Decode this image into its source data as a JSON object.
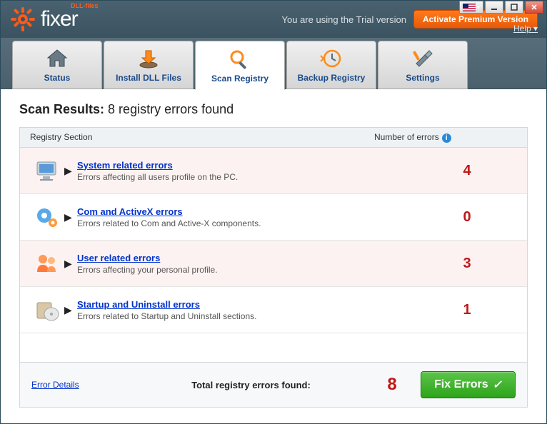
{
  "titlebar": {
    "brand_small": "DLL-files",
    "brand_main": "fixer",
    "trial_text": "You are using the Trial version",
    "activate_label": "Activate Premium Version",
    "help_label": "Help"
  },
  "tabs": {
    "status": "Status",
    "install": "Install DLL Files",
    "scan": "Scan Registry",
    "backup": "Backup Registry",
    "settings": "Settings"
  },
  "heading": {
    "bold": "Scan Results:",
    "rest": " 8 registry errors found"
  },
  "grid_header": {
    "section": "Registry Section",
    "count": "Number of errors"
  },
  "rows": [
    {
      "title": "System related errors",
      "desc": "Errors affecting all users profile on the PC.",
      "count": "4",
      "tint": true
    },
    {
      "title": "Com and ActiveX errors",
      "desc": "Errors related to Com and Active-X components.",
      "count": "0",
      "tint": false
    },
    {
      "title": "User related errors",
      "desc": "Errors affecting your personal profile.",
      "count": "3",
      "tint": true
    },
    {
      "title": "Startup and Uninstall errors",
      "desc": "Errors related to Startup and Uninstall sections.",
      "count": "1",
      "tint": false
    }
  ],
  "footer": {
    "details": "Error Details",
    "total_label": "Total registry errors found:",
    "total_count": "8",
    "fix_label": "Fix Errors"
  }
}
